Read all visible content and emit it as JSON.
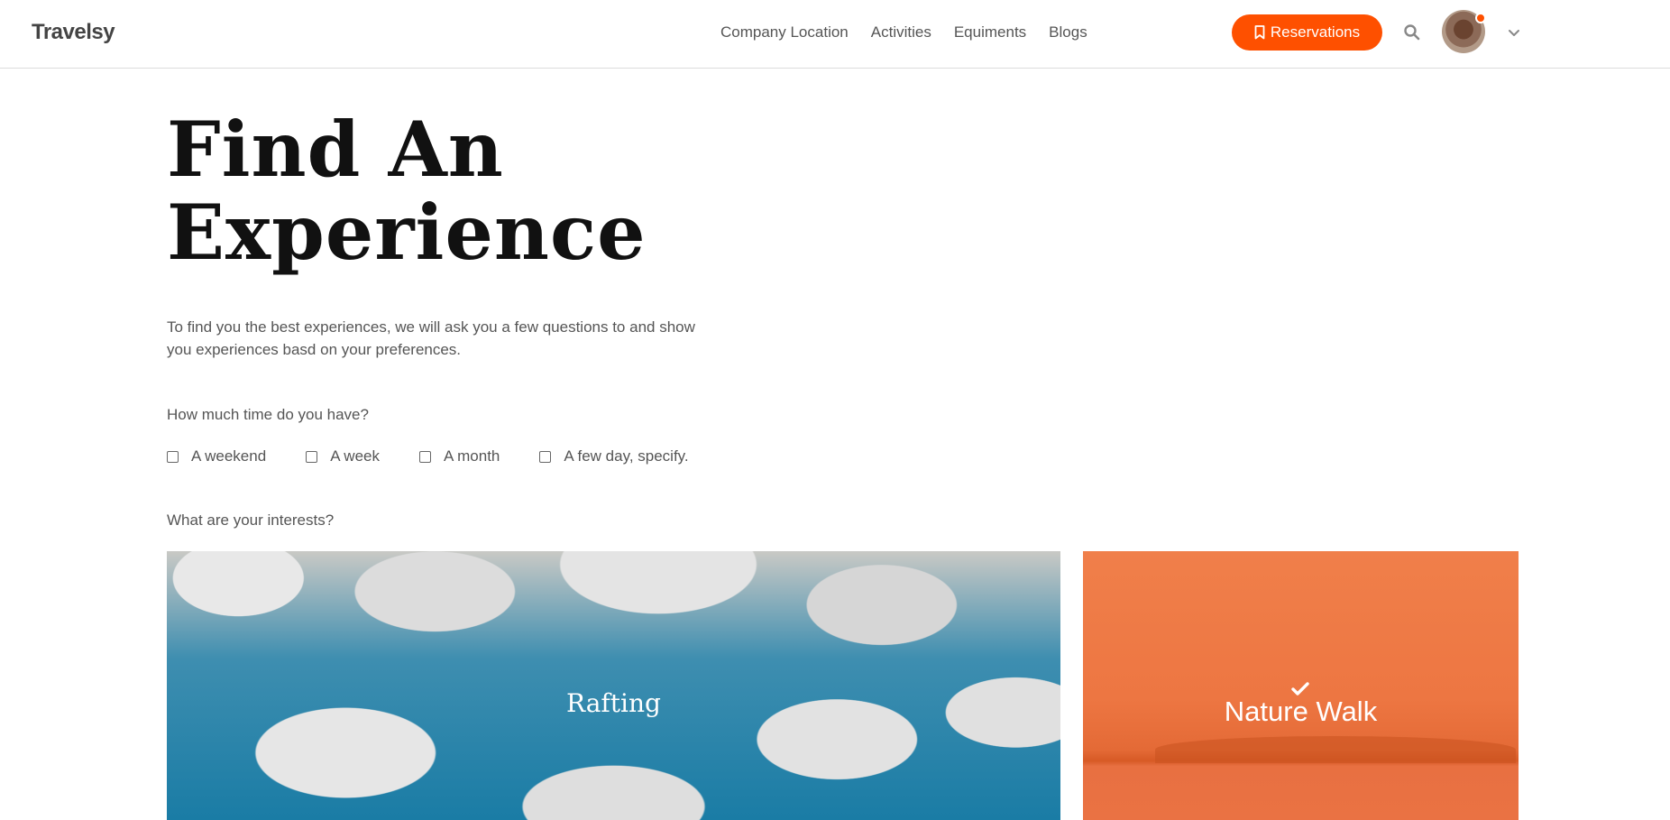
{
  "header": {
    "logo": "Travelsy",
    "nav": [
      "Company Location",
      "Activities",
      "Equiments",
      "Blogs"
    ],
    "reservations_label": "Reservations",
    "accent_color": "#fe5000"
  },
  "main": {
    "title_line1": "Find An",
    "title_line2": "Experience",
    "intro": "To find you the best experiences, we will ask you a few questions to and show you experiences basd on your preferences.",
    "time_question": "How much time do you have?",
    "time_options": [
      "A weekend",
      "A week",
      "A month",
      "A few day, specify."
    ],
    "interests_question": "What are your interests?",
    "interests": [
      {
        "label": "Rafting",
        "selected": false
      },
      {
        "label": "Nature Walk",
        "selected": true
      }
    ]
  }
}
